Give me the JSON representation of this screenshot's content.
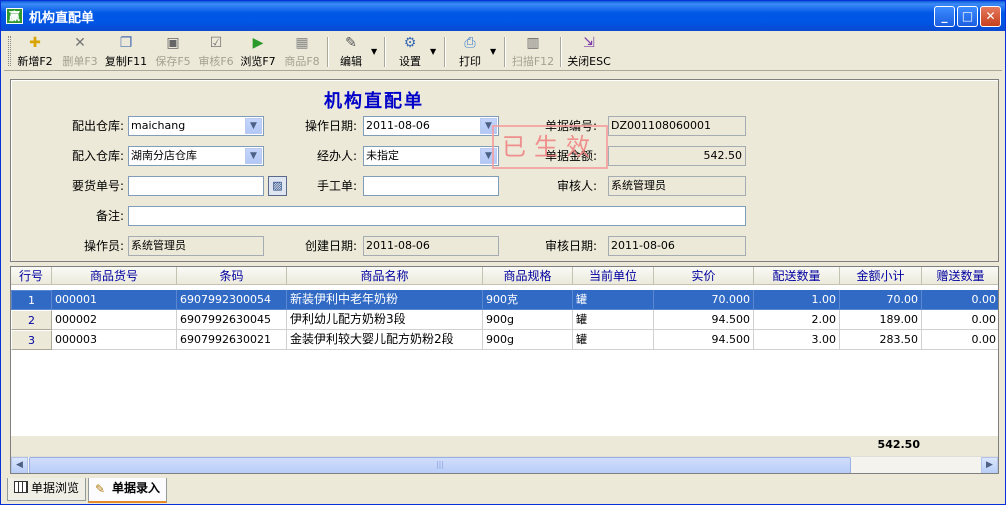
{
  "window": {
    "title": "机构直配单",
    "app_icon_glyph": "赢"
  },
  "toolbar": {
    "buttons": [
      {
        "id": "new",
        "label": "新增F2",
        "icon": "new-doc-icon",
        "enabled": true
      },
      {
        "id": "delete",
        "label": "删单F3",
        "icon": "delete-x-icon",
        "enabled": false
      },
      {
        "id": "copy",
        "label": "复制F11",
        "icon": "copy-icon",
        "enabled": true
      },
      {
        "id": "save",
        "label": "保存F5",
        "icon": "save-disk-icon",
        "enabled": false
      },
      {
        "id": "audit",
        "label": "审核F6",
        "icon": "audit-check-icon",
        "enabled": false
      },
      {
        "id": "browse",
        "label": "浏览F7",
        "icon": "browse-icon",
        "enabled": true
      },
      {
        "id": "product",
        "label": "商品F8",
        "icon": "product-icon",
        "enabled": false
      },
      {
        "id": "edit",
        "label": "编辑",
        "icon": "edit-icon",
        "enabled": true
      },
      {
        "id": "settings",
        "label": "设置",
        "icon": "settings-icon",
        "enabled": true
      },
      {
        "id": "print",
        "label": "打印",
        "icon": "printer-icon",
        "enabled": true
      },
      {
        "id": "scan",
        "label": "扫描F12",
        "icon": "barcode-icon",
        "enabled": false
      },
      {
        "id": "close",
        "label": "关闭ESC",
        "icon": "exit-door-icon",
        "enabled": true
      }
    ]
  },
  "form": {
    "title": "机构直配单",
    "stamp": "已生效",
    "out_warehouse": {
      "label": "配出仓库:",
      "value": "maichang"
    },
    "in_warehouse": {
      "label": "配入仓库:",
      "value": "湖南分店仓库"
    },
    "request_no": {
      "label": "要货单号:",
      "value": ""
    },
    "remark": {
      "label": "备注:",
      "value": ""
    },
    "operator": {
      "label": "操作员:",
      "value": "系统管理员"
    },
    "op_date": {
      "label": "操作日期:",
      "value": "2011-08-06"
    },
    "handler": {
      "label": "经办人:",
      "value": "未指定"
    },
    "manual_no": {
      "label": "手工单:",
      "value": ""
    },
    "create_date": {
      "label": "创建日期:",
      "value": "2011-08-06"
    },
    "doc_no": {
      "label": "单据编号:",
      "value": "DZ001108060001"
    },
    "doc_amount": {
      "label": "单据金额:",
      "value": "542.50"
    },
    "auditor": {
      "label": "审核人:",
      "value": "系统管理员"
    },
    "audit_date": {
      "label": "审核日期:",
      "value": "2011-08-06"
    }
  },
  "grid": {
    "columns": [
      "行号",
      "商品货号",
      "条码",
      "商品名称",
      "商品规格",
      "当前单位",
      "实价",
      "配送数量",
      "金额小计",
      "赠送数量"
    ],
    "rows": [
      {
        "line": "1",
        "code": "000001",
        "barcode": "6907992300054",
        "name": "新装伊利中老年奶粉",
        "spec": "900克",
        "unit": "罐",
        "price": "70.000",
        "qty": "1.00",
        "subtotal": "70.00",
        "gift": "0.00"
      },
      {
        "line": "2",
        "code": "000002",
        "barcode": "6907992630045",
        "name": "伊利幼儿配方奶粉3段",
        "spec": "900g",
        "unit": "罐",
        "price": "94.500",
        "qty": "2.00",
        "subtotal": "189.00",
        "gift": "0.00"
      },
      {
        "line": "3",
        "code": "000003",
        "barcode": "6907992630021",
        "name": "金装伊利较大婴儿配方奶粉2段",
        "spec": "900g",
        "unit": "罐",
        "price": "94.500",
        "qty": "3.00",
        "subtotal": "283.50",
        "gift": "0.00"
      }
    ],
    "selected_row": 0,
    "total": "542.50"
  },
  "tabs": [
    {
      "label": "单据浏览",
      "active": false
    },
    {
      "label": "单据录入",
      "active": true
    }
  ]
}
